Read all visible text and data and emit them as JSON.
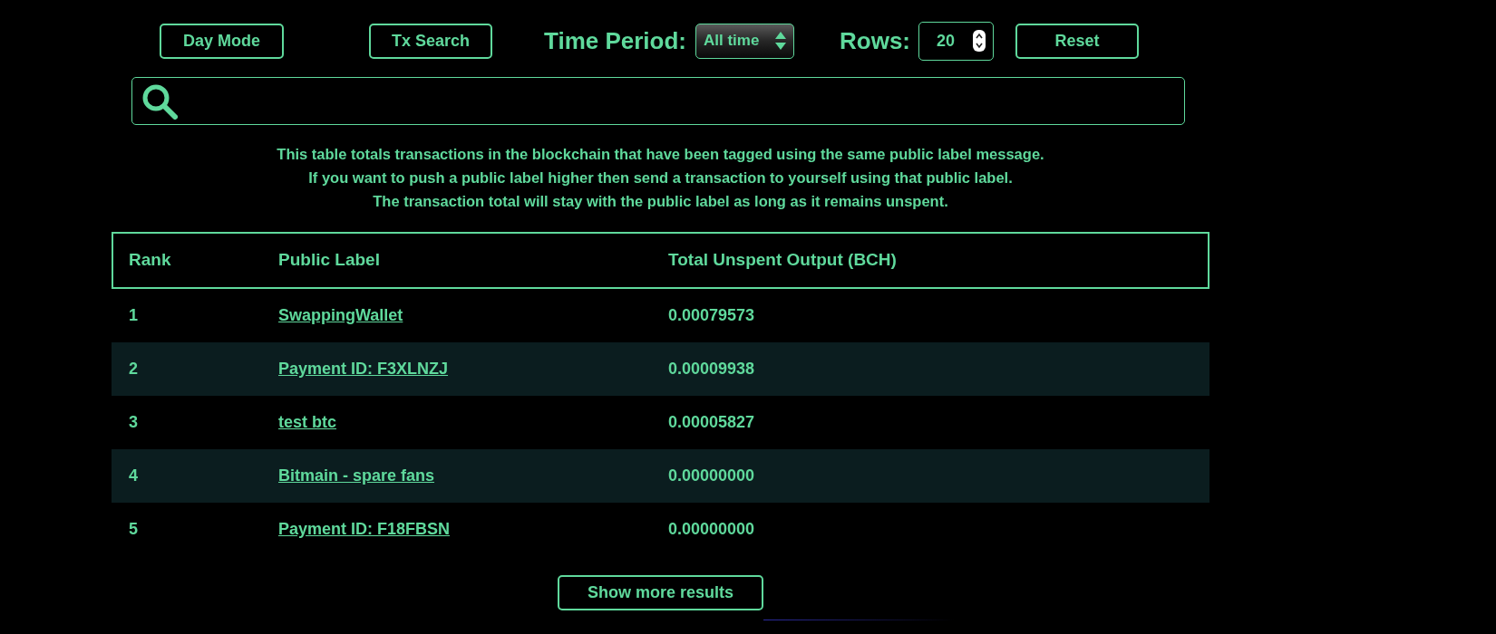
{
  "toolbar": {
    "day_mode_button": "Day Mode",
    "tx_search_button": "Tx Search",
    "time_period": {
      "label": "Time Period:",
      "value": "All time"
    },
    "rows": {
      "label": "Rows:",
      "value": "20"
    },
    "reset_button": "Reset"
  },
  "description": [
    "This table totals transactions in the blockchain that have been tagged using the same public label message.",
    "If you want to push a public label higher then send a transaction to yourself using that public label.",
    "The transaction total will stay with the public label as long as it remains unspent."
  ],
  "table": {
    "columns": [
      "Rank",
      "Public Label",
      "Total Unspent Output (BCH)"
    ],
    "rows": [
      {
        "rank": "1",
        "label": "SwappingWallet",
        "total": "0.00079573"
      },
      {
        "rank": "2",
        "label": "Payment ID: F3XLNZJ",
        "total": "0.00009938"
      },
      {
        "rank": "3",
        "label": "test btc",
        "total": "0.00005827"
      },
      {
        "rank": "4",
        "label": "Bitmain - spare fans",
        "total": "0.00000000"
      },
      {
        "rank": "5",
        "label": "Payment ID: F18FBSN",
        "total": "0.00000000"
      }
    ]
  },
  "show_more_button": "Show more results"
}
